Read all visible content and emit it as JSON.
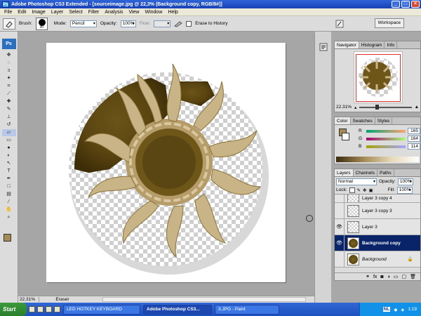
{
  "window": {
    "title": "Adobe Photoshop CS3 Extended - [sourceimage.jpg @ 22,3% (Background copy, RGB/8#)]",
    "app_icon": "Ps",
    "controls": [
      "_",
      "□",
      "×"
    ]
  },
  "menu": [
    "File",
    "Edit",
    "Image",
    "Layer",
    "Select",
    "Filter",
    "Analysis",
    "View",
    "Window",
    "Help"
  ],
  "options": {
    "brush_label": "Brush:",
    "brush_size": "30",
    "mode_label": "Mode:",
    "mode_value": "Pencil",
    "opacity_label": "Opacity:",
    "opacity_value": "100%",
    "flow_label": "Flow:",
    "flow_value": "",
    "erase_history": "Erase to History",
    "workspace": "Workspace"
  },
  "toolbox": {
    "logo": "Ps",
    "tools": [
      "move-tool",
      "marquee-tool",
      "lasso-tool",
      "magic-wand-tool",
      "crop-tool",
      "slice-tool",
      "healing-tool",
      "brush-tool",
      "stamp-tool",
      "history-brush-tool",
      "eraser-tool",
      "gradient-tool",
      "blur-tool",
      "dodge-tool",
      "path-select-tool",
      "type-tool",
      "pen-tool",
      "shape-tool",
      "notes-tool",
      "eyedropper-tool",
      "hand-tool",
      "zoom-tool"
    ],
    "foreground_color": "#a48a55",
    "background_color": "#ffffff"
  },
  "status": {
    "zoom": "22.31%",
    "tool_name": "Eraser"
  },
  "navigator": {
    "tabs": [
      "Navigator",
      "Histogram",
      "Info"
    ],
    "zoom": "22.31%"
  },
  "color_panel": {
    "tabs": [
      "Color",
      "Swatches",
      "Styles"
    ],
    "r_label": "R",
    "r_value": "165",
    "g_label": "G",
    "g_value": "164",
    "b_label": "B",
    "b_value": "114"
  },
  "layers_panel": {
    "tabs": [
      "Layers",
      "Channels",
      "Paths"
    ],
    "blend_mode": "Normal",
    "opacity_label": "Opacity:",
    "opacity_value": "100%",
    "lock_label": "Lock:",
    "fill_label": "Fill:",
    "fill_value": "100%",
    "layers": [
      {
        "name": "Layer 3 copy 4"
      },
      {
        "name": "Layer 3 copy 3"
      },
      {
        "name": "Layer 3"
      },
      {
        "name": "Background copy"
      },
      {
        "name": "Background"
      }
    ]
  },
  "taskbar": {
    "start": "Start",
    "tasks": [
      "LED HOTKEY KEYBOARD",
      "Adobe Photoshop CS3...",
      "3.JPG - Paint"
    ],
    "lang": "NL",
    "clock": "1:19"
  }
}
